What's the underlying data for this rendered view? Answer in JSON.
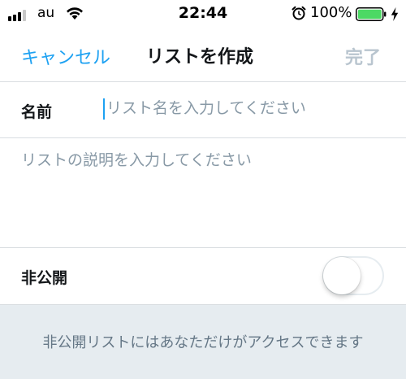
{
  "status_bar": {
    "carrier": "au",
    "time": "22:44",
    "battery_percent": "100%",
    "signal_bars_filled": 3,
    "signal_bars_total": 4,
    "icons": [
      "signal-icon",
      "wifi-icon",
      "alarm-icon",
      "battery-icon",
      "charging-bolt-icon"
    ],
    "battery_color": "#4cd964"
  },
  "nav": {
    "cancel_label": "キャンセル",
    "title": "リストを作成",
    "done_label": "完了"
  },
  "form": {
    "name_label": "名前",
    "name_value": "",
    "name_placeholder": "リスト名を入力してください",
    "description_value": "",
    "description_placeholder": "リストの説明を入力してください",
    "private_label": "非公開",
    "private_enabled": false
  },
  "note": {
    "text": "非公開リストにはあなただけがアクセスできます"
  },
  "colors": {
    "accent": "#1da1f2",
    "disabled": "#b9c5cf",
    "placeholder": "#8899a6",
    "note_background": "#e6ecf0",
    "note_text": "#657786"
  }
}
